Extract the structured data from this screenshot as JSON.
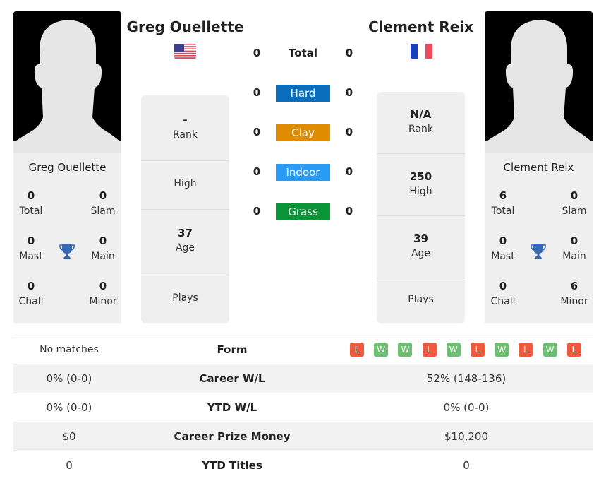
{
  "player1": {
    "name": "Greg Ouellette",
    "card_name": "Greg Ouellette",
    "country": "USA",
    "flag_icon": "us-flag-icon",
    "titles": {
      "total": "0",
      "total_label": "Total",
      "slam": "0",
      "slam_label": "Slam",
      "mast": "0",
      "mast_label": "Mast",
      "main": "0",
      "main_label": "Main",
      "chall": "0",
      "chall_label": "Chall",
      "minor": "0",
      "minor_label": "Minor"
    },
    "rank": {
      "value": "-",
      "label": "Rank"
    },
    "high": {
      "value": "",
      "label": "High"
    },
    "age": {
      "value": "37",
      "label": "Age"
    },
    "plays": {
      "value": "",
      "label": "Plays"
    }
  },
  "player2": {
    "name": "Clement Reix",
    "card_name": "Clement Reix",
    "country": "France",
    "flag_icon": "fr-flag-icon",
    "titles": {
      "total": "6",
      "total_label": "Total",
      "slam": "0",
      "slam_label": "Slam",
      "mast": "0",
      "mast_label": "Mast",
      "main": "0",
      "main_label": "Main",
      "chall": "0",
      "chall_label": "Chall",
      "minor": "6",
      "minor_label": "Minor"
    },
    "rank": {
      "value": "N/A",
      "label": "Rank"
    },
    "high": {
      "value": "250",
      "label": "High"
    },
    "age": {
      "value": "39",
      "label": "Age"
    },
    "plays": {
      "value": "",
      "label": "Plays"
    }
  },
  "h2h": {
    "total": {
      "label": "Total",
      "p1": "0",
      "p2": "0"
    },
    "surfaces": [
      {
        "label": "Hard",
        "p1": "0",
        "p2": "0",
        "color": "#0a6ebd"
      },
      {
        "label": "Clay",
        "p1": "0",
        "p2": "0",
        "color": "#e08c00"
      },
      {
        "label": "Indoor",
        "p1": "0",
        "p2": "0",
        "color": "#2a9bf5"
      },
      {
        "label": "Grass",
        "p1": "0",
        "p2": "0",
        "color": "#0b9438"
      }
    ]
  },
  "comparison": {
    "form": {
      "label": "Form",
      "p1": "No matches",
      "p2_results": [
        "L",
        "W",
        "W",
        "L",
        "W",
        "L",
        "W",
        "L",
        "W",
        "L"
      ]
    },
    "rows": [
      {
        "label": "Career W/L",
        "p1": "0% (0-0)",
        "p2": "52% (148-136)"
      },
      {
        "label": "YTD W/L",
        "p1": "0% (0-0)",
        "p2": "0% (0-0)"
      },
      {
        "label": "Career Prize Money",
        "p1": "$0",
        "p2": "$10,200"
      },
      {
        "label": "YTD Titles",
        "p1": "0",
        "p2": "0"
      }
    ]
  },
  "colors": {
    "win": "#6fbf73",
    "loss": "#ee5a40",
    "trophy": "#3468b5"
  }
}
